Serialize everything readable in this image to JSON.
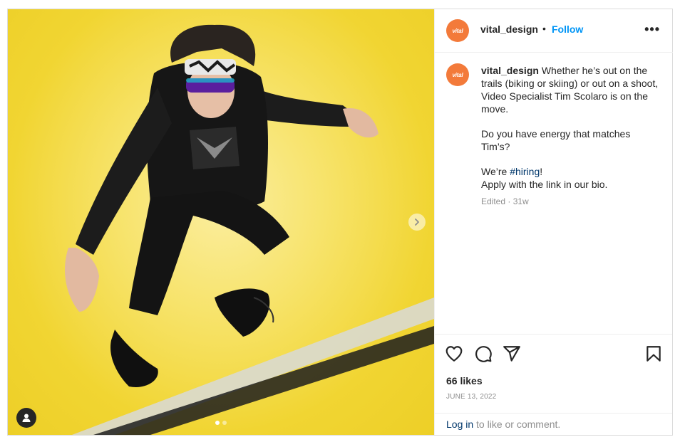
{
  "post": {
    "username": "vital_design",
    "avatar_text": "vital",
    "follow_label": "Follow",
    "separator": "•",
    "more_label": "•••",
    "accent_color": "#0095f6",
    "avatar_color": "#f37a3a"
  },
  "caption": {
    "username": "vital_design",
    "paragraph1": "Whether he’s out on the trails (biking or skiing) or out on a shoot, Video Specialist Tim Scolaro is on the move.",
    "paragraph2": "Do you have energy that matches Tim’s?",
    "paragraph3_prefix": "We’re ",
    "hashtag": "#hiring",
    "paragraph3_suffix": "!",
    "paragraph4": "Apply with the link in our bio.",
    "edited": "Edited",
    "meta_sep": " · ",
    "age": "31w"
  },
  "actions": {
    "icons": [
      "heart-icon",
      "comment-icon",
      "share-icon",
      "bookmark-icon"
    ],
    "likes": "66 likes",
    "date": "JUNE 13, 2022"
  },
  "footer": {
    "login_link": "Log in",
    "login_rest": " to like or comment."
  },
  "media": {
    "slide_count": 2,
    "current_slide": 1,
    "background_color": "#f1d532"
  }
}
